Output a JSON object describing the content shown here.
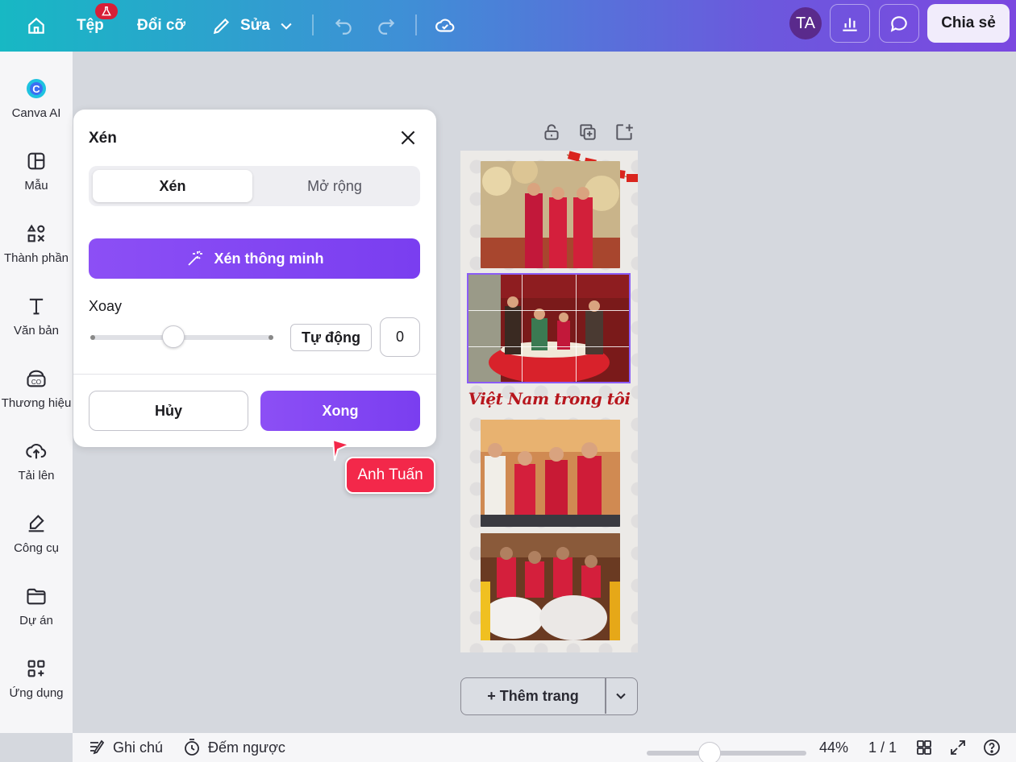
{
  "topbar": {
    "file_label": "Tệp",
    "resize_label": "Đổi cỡ",
    "edit_label": "Sửa",
    "avatar_initials": "TA",
    "share_label": "Chia sẻ"
  },
  "sidebar": {
    "items": [
      {
        "label": "Canva AI",
        "icon": "canva-ai-icon"
      },
      {
        "label": "Mẫu",
        "icon": "template-icon"
      },
      {
        "label": "Thành phần",
        "icon": "elements-icon"
      },
      {
        "label": "Văn bản",
        "icon": "text-icon"
      },
      {
        "label": "Thương hiệu",
        "icon": "brand-icon"
      },
      {
        "label": "Tải lên",
        "icon": "upload-icon"
      },
      {
        "label": "Công cụ",
        "icon": "tools-icon"
      },
      {
        "label": "Dự án",
        "icon": "folder-icon"
      },
      {
        "label": "Ứng dụng",
        "icon": "apps-icon"
      }
    ]
  },
  "crop_panel": {
    "title": "Xén",
    "tab_crop": "Xén",
    "tab_expand": "Mở rộng",
    "smart_crop_label": "Xén thông minh",
    "rotate_label": "Xoay",
    "rotate_value": 0.45,
    "auto_label": "Tự động",
    "rotate_input": "0",
    "cancel_label": "Hủy",
    "done_label": "Xong"
  },
  "collaborator": {
    "name": "Anh Tuấn"
  },
  "design": {
    "slogan": "Việt Nam trong tôi"
  },
  "add_page": {
    "label": "+ Thêm trang"
  },
  "bottombar": {
    "notes_label": "Ghi chú",
    "timer_label": "Đếm ngược",
    "zoom": "44%",
    "pages": "1 / 1"
  },
  "colors": {
    "accent": "#7d42f1",
    "collaborator": "#f3284a",
    "slogan": "#b7161d"
  }
}
